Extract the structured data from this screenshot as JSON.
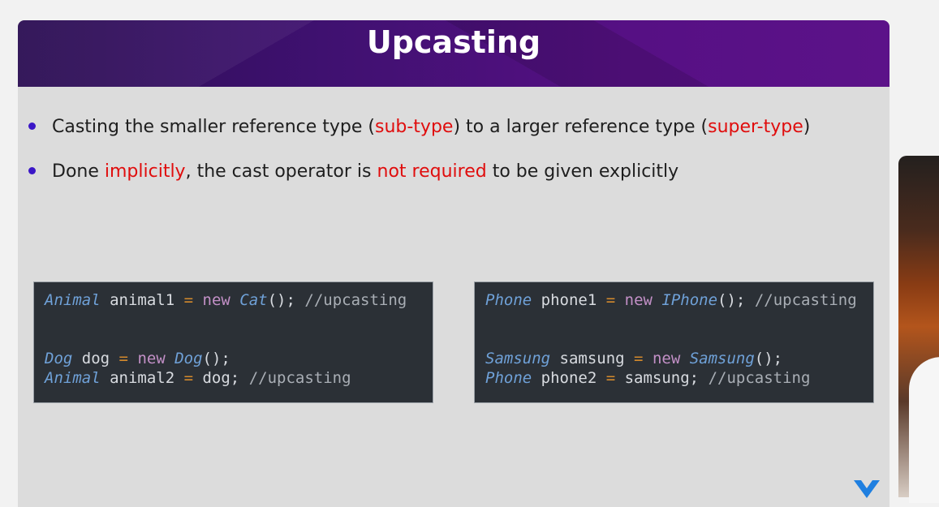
{
  "slide": {
    "title": "Upcasting",
    "bullets": [
      {
        "parts": [
          {
            "text": "Casting the smaller reference type (",
            "hl": false
          },
          {
            "text": "sub-type",
            "hl": true
          },
          {
            "text": ") to a larger reference type (",
            "hl": false
          },
          {
            "text": "super-type",
            "hl": true
          },
          {
            "text": ")",
            "hl": false
          }
        ]
      },
      {
        "parts": [
          {
            "text": "Done ",
            "hl": false
          },
          {
            "text": "implicitly",
            "hl": true
          },
          {
            "text": ", the cast operator is ",
            "hl": false
          },
          {
            "text": "not required",
            "hl": true
          },
          {
            "text": " to be given explicitly",
            "hl": false
          }
        ]
      }
    ]
  },
  "code_boxes": [
    {
      "lines": [
        [
          [
            "Animal",
            "type"
          ],
          [
            " animal1 ",
            ""
          ],
          [
            "=",
            "op"
          ],
          [
            " ",
            ""
          ],
          [
            "new",
            "kw"
          ],
          [
            " ",
            ""
          ],
          [
            "Cat",
            "type"
          ],
          [
            "(); ",
            ""
          ],
          [
            "//upcasting",
            "cm"
          ]
        ],
        [],
        [],
        [
          [
            "Dog",
            "type"
          ],
          [
            " dog ",
            ""
          ],
          [
            "=",
            "op"
          ],
          [
            " ",
            ""
          ],
          [
            "new",
            "kw"
          ],
          [
            " ",
            ""
          ],
          [
            "Dog",
            "type"
          ],
          [
            "();",
            ""
          ]
        ],
        [
          [
            "Animal",
            "type"
          ],
          [
            " animal2 ",
            ""
          ],
          [
            "=",
            "op"
          ],
          [
            " dog; ",
            ""
          ],
          [
            "//upcasting",
            "cm"
          ]
        ]
      ]
    },
    {
      "lines": [
        [
          [
            "Phone",
            "type"
          ],
          [
            " phone1 ",
            ""
          ],
          [
            "=",
            "op"
          ],
          [
            " ",
            ""
          ],
          [
            "new",
            "kw"
          ],
          [
            " ",
            ""
          ],
          [
            "IPhone",
            "type"
          ],
          [
            "(); ",
            ""
          ],
          [
            "//upcasting",
            "cm"
          ]
        ],
        [],
        [],
        [
          [
            "Samsung",
            "type"
          ],
          [
            " samsung ",
            ""
          ],
          [
            "=",
            "op"
          ],
          [
            " ",
            ""
          ],
          [
            "new",
            "kw"
          ],
          [
            " ",
            ""
          ],
          [
            "Samsung",
            "type"
          ],
          [
            "();",
            ""
          ]
        ],
        [
          [
            "Phone",
            "type"
          ],
          [
            " phone2 ",
            ""
          ],
          [
            "=",
            "op"
          ],
          [
            " samsung; ",
            ""
          ],
          [
            "//upcasting",
            "cm"
          ]
        ]
      ]
    }
  ],
  "colors": {
    "accent_red": "#e00d0d",
    "bullet_dot": "#3b17c7",
    "header_purple": "#4a0f7a",
    "code_bg": "#2b3036"
  },
  "icons": {
    "brand_logo": "chevron-v-logo"
  }
}
